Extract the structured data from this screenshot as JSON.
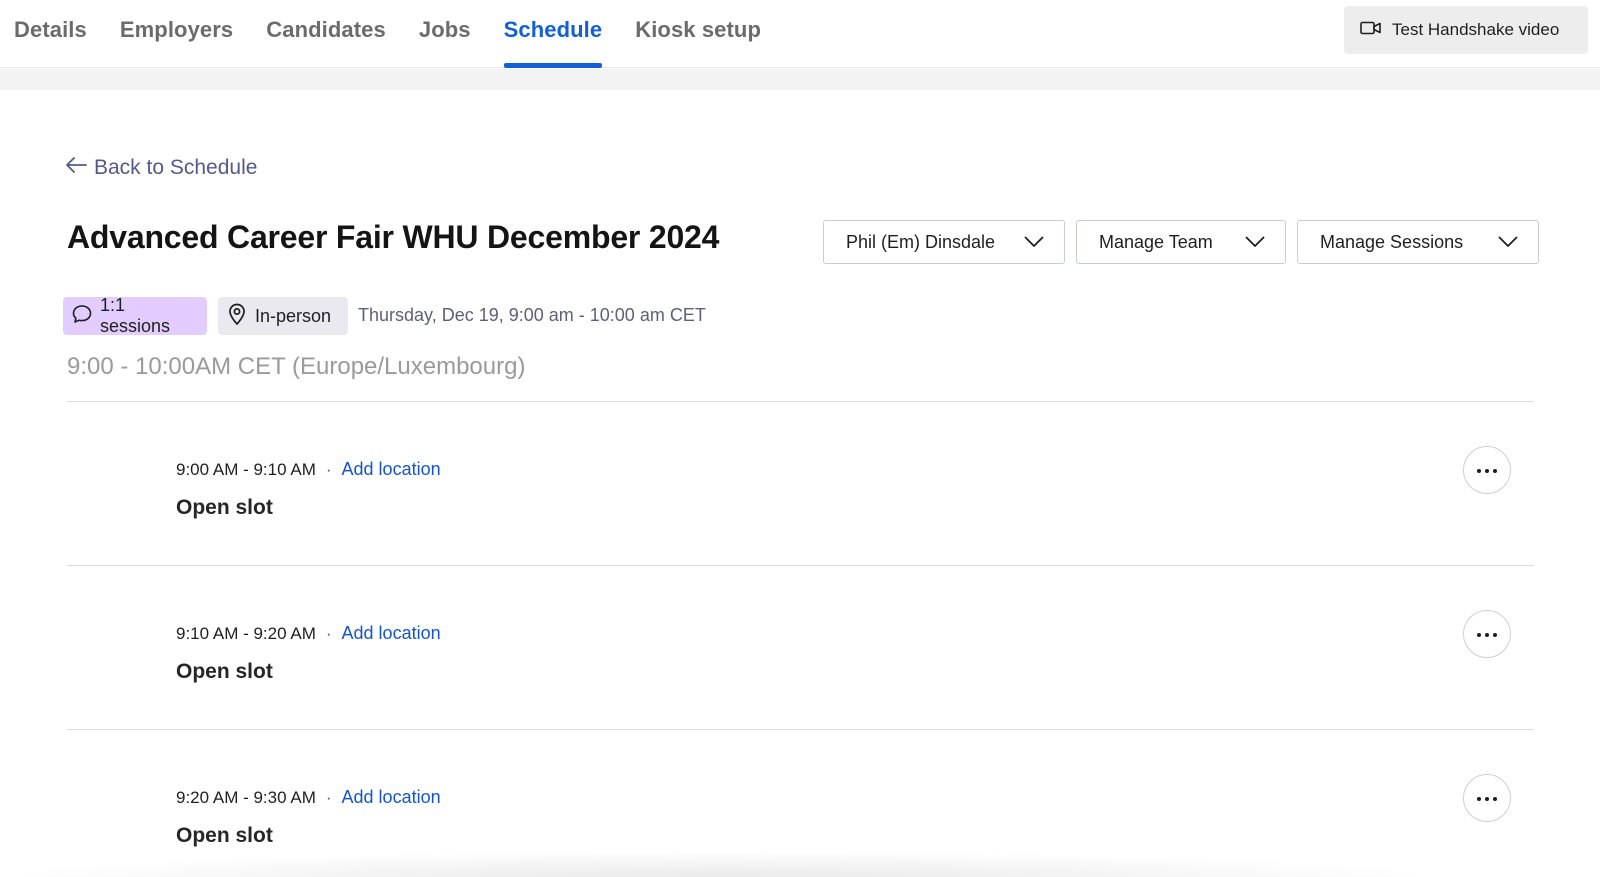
{
  "nav": {
    "tabs": [
      {
        "label": "Details"
      },
      {
        "label": "Employers"
      },
      {
        "label": "Candidates"
      },
      {
        "label": "Jobs"
      },
      {
        "label": "Schedule",
        "active": true
      },
      {
        "label": "Kiosk setup"
      }
    ],
    "video_button": {
      "label": "Test Handshake video",
      "icon": "video-camera-icon"
    }
  },
  "page": {
    "back_link": "Back to Schedule",
    "title": "Advanced Career Fair WHU December 2024",
    "dropdowns": {
      "user": "Phil (Em) Dinsdale",
      "team": "Manage Team",
      "sessions": "Manage Sessions"
    },
    "badges": {
      "sessions": {
        "label": "1:1 sessions",
        "icon": "chat-bubble-icon",
        "color": "#e3ccff"
      },
      "mode": {
        "label": "In-person",
        "icon": "map-pin-icon",
        "color": "#e9e9ef"
      }
    },
    "date": "Thursday, Dec 19, 9:00 am - 10:00 am CET",
    "timezone_heading": "9:00 - 10:00AM CET (Europe/Luxembourg)"
  },
  "slots": [
    {
      "time": "9:00 AM - 9:10 AM",
      "separator": "·",
      "location_link": "Add location",
      "title": "Open slot"
    },
    {
      "time": "9:10 AM - 9:20 AM",
      "separator": "·",
      "location_link": "Add location",
      "title": "Open slot"
    },
    {
      "time": "9:20 AM - 9:30 AM",
      "separator": "·",
      "location_link": "Add location",
      "title": "Open slot"
    }
  ],
  "colors": {
    "accent": "#1260d6",
    "link": "#1454d3",
    "back_link": "#55598a"
  }
}
